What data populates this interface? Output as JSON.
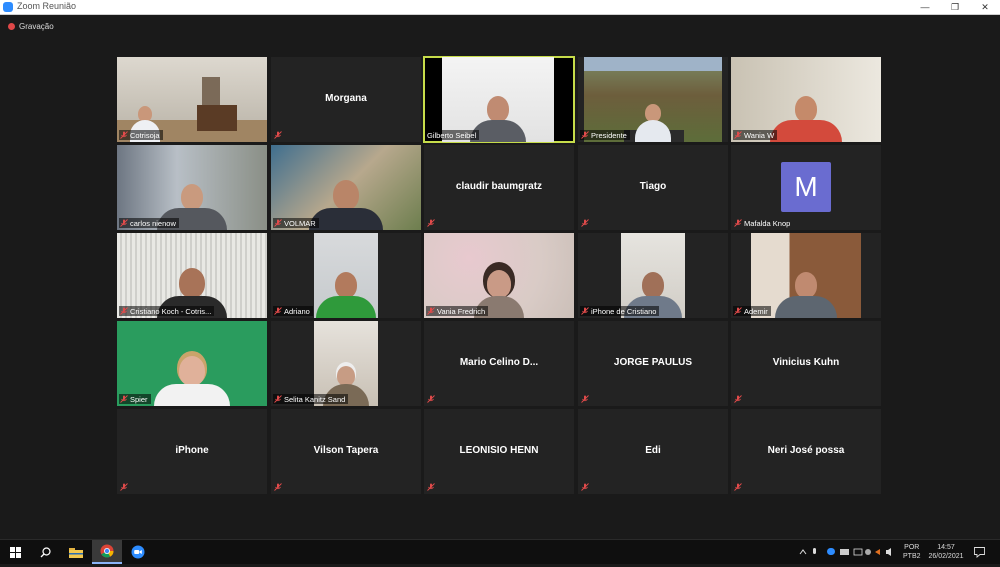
{
  "window": {
    "title": "Zoom Reunião",
    "minimize": "—",
    "maximize": "❐",
    "close": "✕"
  },
  "recording": {
    "label": "Gravação"
  },
  "tiles": [
    {
      "label": "Cotrisoja"
    },
    {
      "center_name": "Morgana"
    },
    {
      "label": "Gilberto  Seibel"
    },
    {
      "label": "Presidente"
    },
    {
      "label": "Wania W"
    },
    {
      "label": "carlos nienow"
    },
    {
      "label": "VOLMAR"
    },
    {
      "center_name": "claudir baumgratz"
    },
    {
      "center_name": "Tiago"
    },
    {
      "label": "Mafalda Knop",
      "avatar_letter": "M"
    },
    {
      "label": "Cristiano Koch - Cotris..."
    },
    {
      "label": "Adriano"
    },
    {
      "label": "Vania Fredrich"
    },
    {
      "label": "iPhone de Cristiano"
    },
    {
      "label": "Ademir"
    },
    {
      "label": "Spier"
    },
    {
      "label": "Selita Kanitz Sand"
    },
    {
      "center_name": "Mario   Celino   D..."
    },
    {
      "center_name": "JORGE PAULUS"
    },
    {
      "center_name": "Vinicius Kuhn"
    },
    {
      "center_name": "iPhone"
    },
    {
      "center_name": "Vilson Tapera"
    },
    {
      "center_name": "LEONISIO HENN"
    },
    {
      "center_name": "Edi"
    },
    {
      "center_name": "Neri José possa"
    }
  ],
  "taskbar": {
    "lang_top": "POR",
    "lang_bottom": "PTB2",
    "time": "14:57",
    "date": "26/02/2021"
  }
}
